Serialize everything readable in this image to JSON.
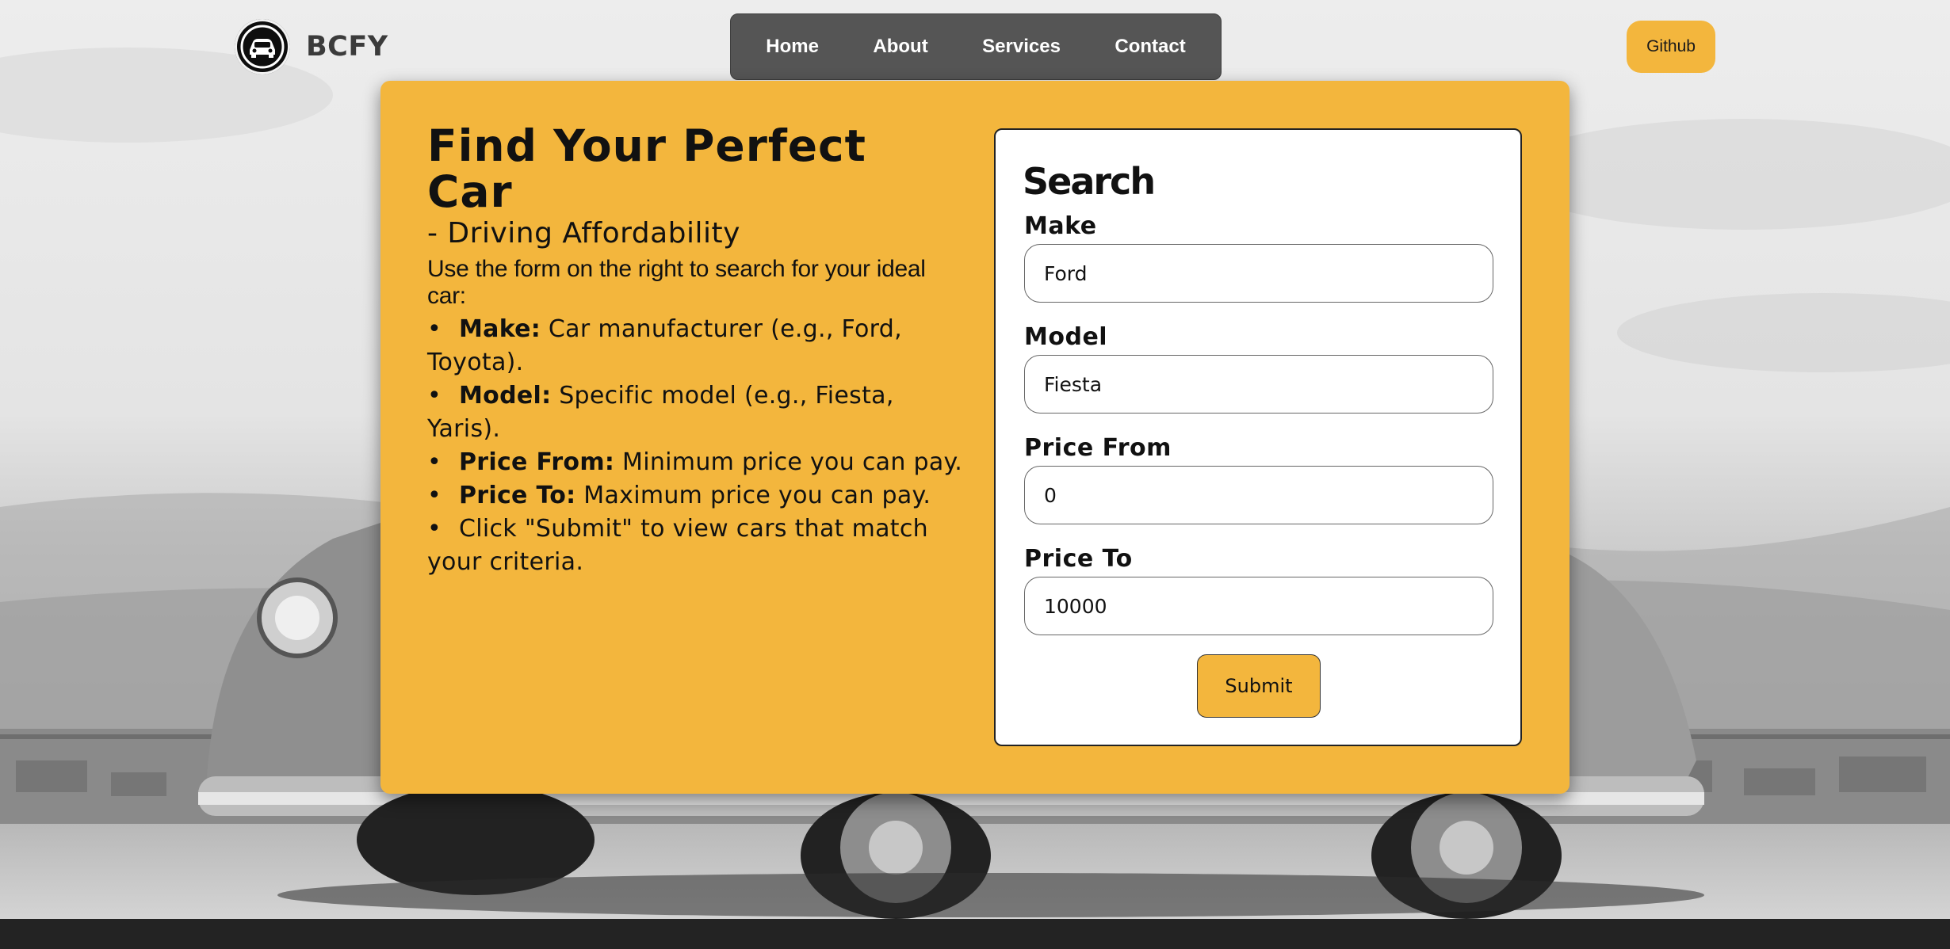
{
  "brand": {
    "name": "BCFY"
  },
  "nav": {
    "items": [
      "Home",
      "About",
      "Services",
      "Contact"
    ]
  },
  "github": {
    "label": "Github"
  },
  "intro": {
    "title": "Find Your Perfect Car",
    "subtitle": "- Driving Affordability",
    "lead": "Use the form on the right to search for your ideal car:",
    "items": [
      {
        "term": "Make:",
        "text": " Car manufacturer (e.g., Ford, Toyota)."
      },
      {
        "term": "Model:",
        "text": " Specific model (e.g., Fiesta, Yaris)."
      },
      {
        "term": "Price From:",
        "text": " Minimum price you can pay."
      },
      {
        "term": "Price To:",
        "text": " Maximum price you can pay."
      },
      {
        "term": "",
        "text": "Click \"Submit\" to view cars that match your criteria."
      }
    ],
    "bullet": "•"
  },
  "search": {
    "title": "Search",
    "fields": [
      {
        "label": "Make",
        "value": "Ford"
      },
      {
        "label": "Model",
        "value": "Fiesta"
      },
      {
        "label": "Price From",
        "value": "0"
      },
      {
        "label": "Price To",
        "value": "10000"
      }
    ],
    "submit_label": "Submit"
  },
  "icons": {
    "logo": "car-logo-icon"
  },
  "colors": {
    "accent": "#f3b63d",
    "nav_bg": "#555555",
    "footer": "#232323"
  }
}
